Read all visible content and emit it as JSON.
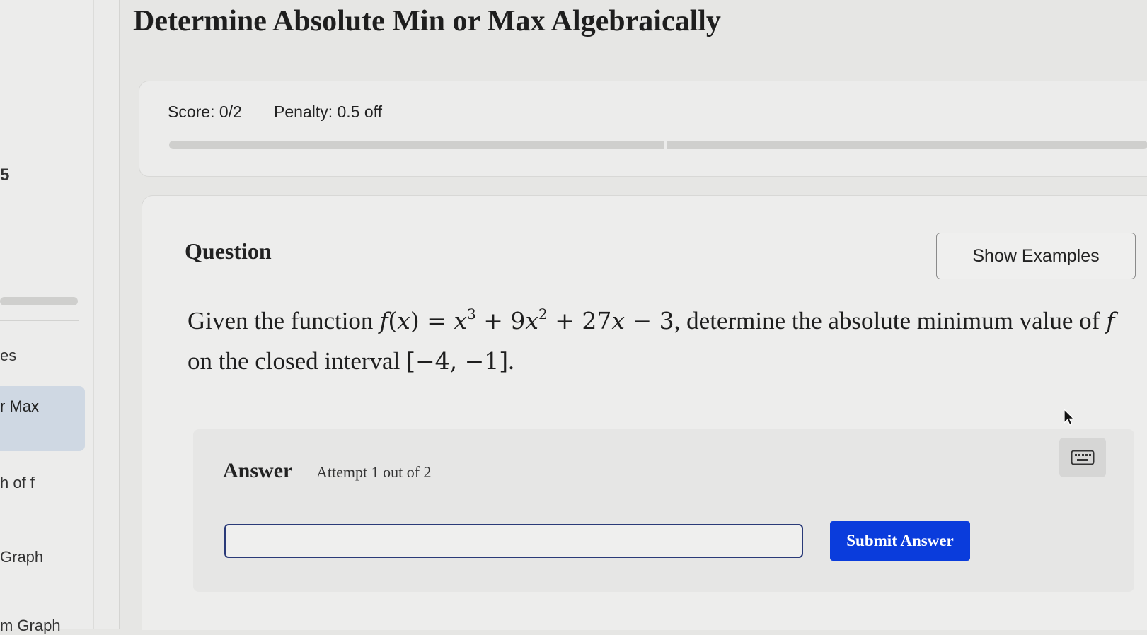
{
  "page": {
    "title": "Determine Absolute Min or Max Algebraically"
  },
  "sidebar": {
    "number": "5",
    "items": [
      {
        "label": "es",
        "active": false
      },
      {
        "label": "r Max",
        "active": true
      },
      {
        "label": "h of f",
        "active": false
      },
      {
        "label": "Graph",
        "active": false
      },
      {
        "label": "m Graph",
        "active": false
      }
    ]
  },
  "score": {
    "score_label": "Score: 0/2",
    "penalty_label": "Penalty: 0.5 off",
    "progress": 0
  },
  "question": {
    "heading": "Question",
    "show_examples_label": "Show Examples",
    "text_intro": "Given the function",
    "function_name": "f",
    "function_var": "x",
    "text_mid": ", determine the absolute minimum value of",
    "text_mid2": "on the closed interval",
    "interval": "[−4, −1]",
    "text_end": "."
  },
  "answer": {
    "heading": "Answer",
    "attempt_text": "Attempt 1 out of 2",
    "input_value": "",
    "input_placeholder": "",
    "submit_label": "Submit Answer"
  },
  "colors": {
    "accent": "#0a3cdc",
    "input_border": "#2a3a78",
    "active_nav": "#cfd8e3"
  },
  "icons": {
    "keyboard": "keyboard-icon",
    "cursor": "mouse-pointer-icon"
  }
}
